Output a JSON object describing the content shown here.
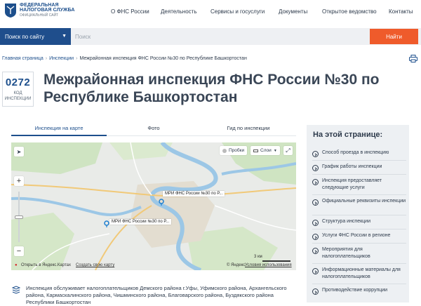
{
  "header": {
    "logo_line1": "ФЕДЕРАЛЬНАЯ",
    "logo_line2": "НАЛОГОВАЯ СЛУЖБА",
    "logo_sub": "ОФИЦИАЛЬНЫЙ САЙТ",
    "nav": [
      "О ФНС России",
      "Деятельность",
      "Сервисы и госуслуги",
      "Документы",
      "Открытое ведомство",
      "Контакты"
    ]
  },
  "search": {
    "scope_label": "Поиск по сайту",
    "placeholder": "Поиск",
    "value": "",
    "button_label": "Найти"
  },
  "breadcrumb": [
    "Главная страница",
    "Инспекции",
    "Межрайонная инспекция ФНС России №30 по Республике Башкортостан"
  ],
  "code": {
    "number": "0272",
    "label_line1": "КОД",
    "label_line2": "ИНСПЕКЦИИ"
  },
  "title_line1": "Межрайонная инспекция ФНС России №30 по",
  "title_line2": "Республике Башкортостан",
  "tabs": [
    "Инспекция на карте",
    "Фото",
    "Гид по инспекции"
  ],
  "map": {
    "traffic_label": "Пробки",
    "layers_label": "Слои",
    "pin1": "МРИ ФНС России №30 по Р...",
    "pin2": "МРИ ФНС России №30 по Р...",
    "scale_label": "3 км",
    "open_label": "Открыть в Яндекс.Картах",
    "create_label": "Создать свою карту",
    "copyright": "© Яндекс",
    "terms": "Условия использования"
  },
  "sidebar": {
    "title": "На этой странице:",
    "items": [
      "Способ проезда в инспекцию",
      "График работы инспекции",
      "Инспекция предоставляет следующие услуги",
      "Официальные реквизиты инспекции",
      "Структура инспекции",
      "Услуги ФНС России в регионе",
      "Мероприятия для налогоплательщиков",
      "Информационные материалы для налогоплательщиков",
      "Противодействие коррупции"
    ]
  },
  "description": "Инспекция обслуживает налогоплательщиков Демского района г.Уфы, Уфимского района, Архангельского района, Кармаскалинского района, Чишминского района, Благоварского района, Буздякского района Республики Башкортостан",
  "colors": {
    "brand": "#1f4e8c",
    "accent": "#ef5b2b",
    "sidebar_bg": "#edf0f3"
  }
}
